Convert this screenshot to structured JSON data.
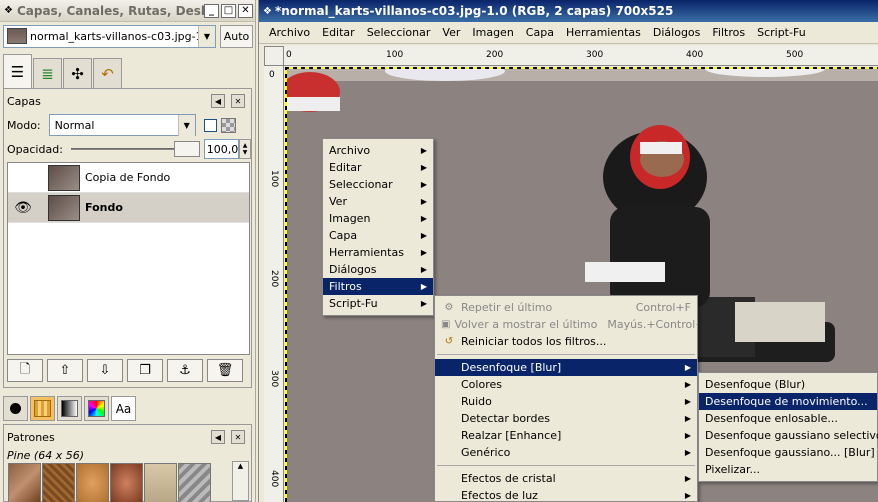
{
  "dock": {
    "title": "Capas, Canales, Rutas, Desha...",
    "image_select": "normal_karts-villanos-c03.jpg-1",
    "auto_label": "Auto",
    "layers_panel": {
      "title": "Capas",
      "mode_label": "Modo:",
      "mode_value": "Normal",
      "opacity_label": "Opacidad:",
      "opacity_value": "100,0",
      "layers": [
        {
          "name": "Copia de Fondo",
          "visible": false
        },
        {
          "name": "Fondo",
          "visible": true,
          "selected": true
        }
      ]
    },
    "patterns_panel": {
      "title": "Patrones",
      "selected_pattern": "Pine (64 x 56)",
      "brush_label": "Aa"
    }
  },
  "image_window": {
    "title": "*normal_karts-villanos-c03.jpg-1.0 (RGB, 2 capas) 700x525",
    "menu": [
      "Archivo",
      "Editar",
      "Seleccionar",
      "Ver",
      "Imagen",
      "Capa",
      "Herramientas",
      "Diálogos",
      "Filtros",
      "Script-Fu"
    ],
    "hruler_labels": [
      "0",
      "100",
      "200",
      "300",
      "400",
      "500"
    ],
    "vruler_labels": [
      "0",
      "100",
      "200",
      "300",
      "400"
    ]
  },
  "context_menu": {
    "items": [
      {
        "label": "Archivo"
      },
      {
        "label": "Editar"
      },
      {
        "label": "Seleccionar"
      },
      {
        "label": "Ver"
      },
      {
        "label": "Imagen"
      },
      {
        "label": "Capa"
      },
      {
        "label": "Herramientas"
      },
      {
        "label": "Diálogos"
      },
      {
        "label": "Filtros",
        "highlighted": true
      },
      {
        "label": "Script-Fu"
      }
    ]
  },
  "filters_menu": {
    "repeat": {
      "label": "Repetir el último",
      "accel": "Control+F"
    },
    "reshow": {
      "label": "Volver a mostrar el último",
      "accel": "Mayús.+Control+F"
    },
    "reset": {
      "label": "Reiniciar todos los filtros..."
    },
    "items": [
      "Desenfoque [Blur]",
      "Colores",
      "Ruido",
      "Detectar bordes",
      "Realzar [Enhance]",
      "Genérico"
    ],
    "items2": [
      "Efectos de cristal",
      "Efectos de luz"
    ]
  },
  "blur_menu": {
    "items": [
      "Desenfoque (Blur)",
      "Desenfoque de movimiento...",
      "Desenfoque enlosable...",
      "Desenfoque gaussiano selectivo...",
      "Desenfoque gaussiano... [Blur]",
      "Pixelizar..."
    ]
  },
  "colors": {
    "selection_highlight": "#0a246a",
    "title_active": "#0a246a"
  }
}
